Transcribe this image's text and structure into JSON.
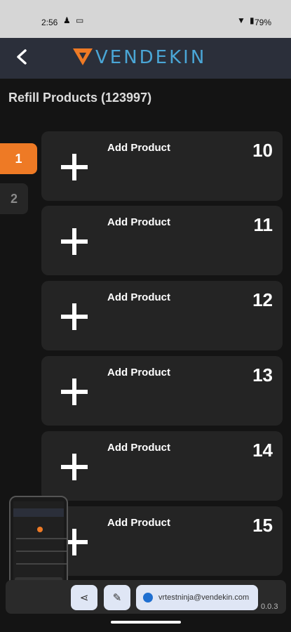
{
  "status_bar": {
    "time": "2:56",
    "battery": "79%"
  },
  "app_bar": {
    "brand": "VENDEKIN"
  },
  "page_title": "Refill Products (123997)",
  "pages": [
    "1",
    "2"
  ],
  "slots": [
    {
      "label": "Add Product",
      "number": "10"
    },
    {
      "label": "Add Product",
      "number": "11"
    },
    {
      "label": "Add Product",
      "number": "12"
    },
    {
      "label": "Add Product",
      "number": "13"
    },
    {
      "label": "Add Product",
      "number": "14"
    },
    {
      "label": "Add Product",
      "number": "15"
    }
  ],
  "bottom_toolbar": {
    "account_email": "vrtestninja@vendekin.com",
    "version": "0.0.3"
  },
  "colors": {
    "accent": "#ee7a25",
    "brand_blue": "#4aa6d6",
    "app_bar": "#2b2f3a"
  }
}
